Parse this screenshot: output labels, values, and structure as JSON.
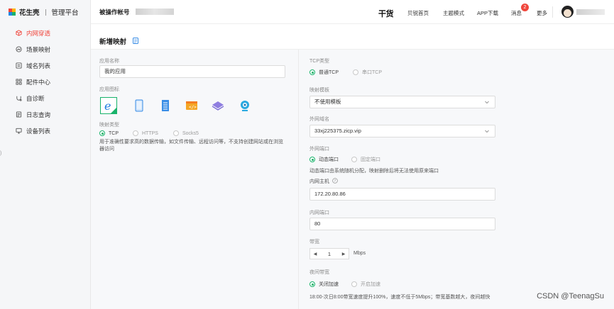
{
  "brand": {
    "name": "花生壳",
    "sub": "管理平台"
  },
  "sidebar": {
    "items": [
      {
        "label": "内网穿透",
        "icon": "cube-icon",
        "active": true
      },
      {
        "label": "场景映射",
        "icon": "scene-icon",
        "active": false
      },
      {
        "label": "域名列表",
        "icon": "domain-list-icon",
        "active": false
      },
      {
        "label": "配件中心",
        "icon": "grid-icon",
        "active": false
      },
      {
        "label": "自诊断",
        "icon": "diagnose-icon",
        "active": false
      },
      {
        "label": "日志查询",
        "icon": "log-icon",
        "active": false
      },
      {
        "label": "设备列表",
        "icon": "monitor-icon",
        "active": false
      }
    ]
  },
  "header": {
    "account_label": "被操作帐号",
    "brand_mark": "干货",
    "links": [
      "贝锐首页",
      "主题模式",
      "APP下载",
      "消息",
      "更多"
    ],
    "message_badge": "2"
  },
  "page": {
    "title": "新增映射"
  },
  "left": {
    "app_name_label": "应用名称",
    "app_name_value": "我的应用",
    "app_icon_label": "应用图标",
    "app_icons": [
      "ie-icon",
      "tablet-icon",
      "document-icon",
      "code-window-icon",
      "layers-icon",
      "webcam-icon"
    ],
    "mapping_type_label": "映射类型",
    "mapping_types": [
      "TCP",
      "HTTPS",
      "Socks5"
    ],
    "mapping_type_selected": "TCP",
    "mapping_desc": "用于准确性要求高的数据传输，如文件传输、远程访问等，不支持创建网站或在浏览器访问"
  },
  "right": {
    "tcp_type_label": "TCP类型",
    "tcp_types": [
      "普通TCP",
      "串口TCP"
    ],
    "template_label": "映射模板",
    "template_value": "不使用模板",
    "domain_label": "外网域名",
    "domain_value": "33xj225375.zicp.vip",
    "port_label": "外网端口",
    "port_types": [
      "动态端口",
      "固定端口"
    ],
    "port_desc": "动态端口由系统随机分配，映射删除后将无法使用原来端口",
    "host_label": "内网主机",
    "host_value": "172.20.80.86",
    "inner_port_label": "内网端口",
    "inner_port_value": "80",
    "bandwidth_label": "带宽",
    "bandwidth_value": "1",
    "bandwidth_unit": "Mbps",
    "night_label": "夜间带宽",
    "night_options": [
      "关闭加速",
      "开启加速"
    ],
    "night_desc": "18:00-次日8:00带宽速度提升100%，速度不低于5Mbps；带宽基数越大，夜间越快"
  },
  "watermark": "CSDN @TeenagSu",
  "colors": {
    "accent": "#f0463c",
    "radio": "#19b36b"
  }
}
